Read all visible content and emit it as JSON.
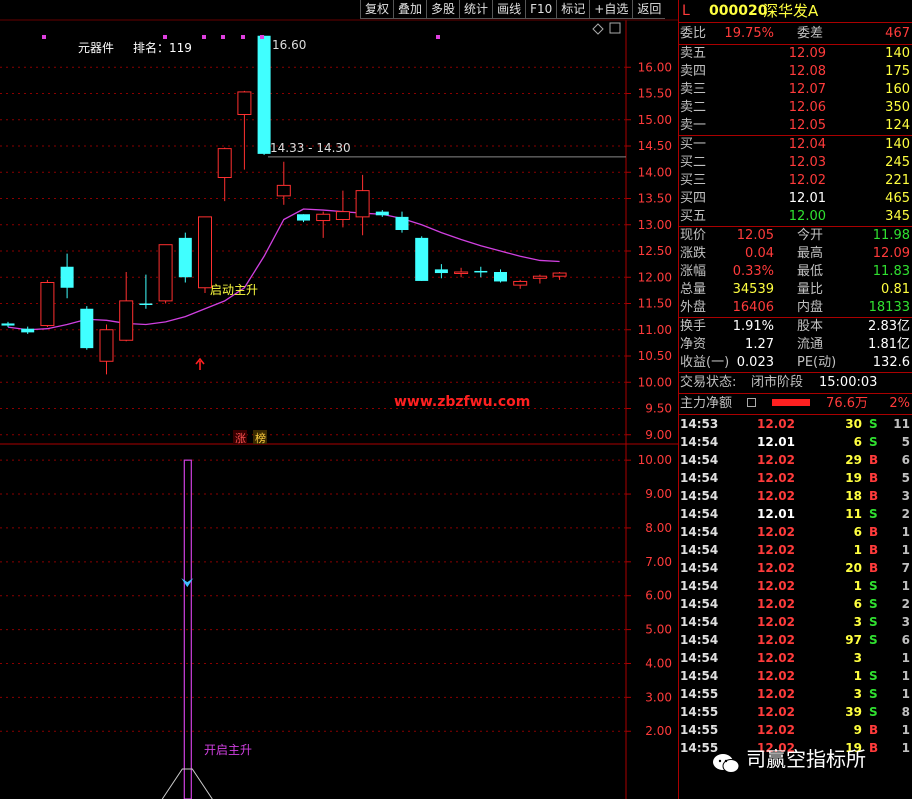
{
  "toolbar": {
    "items": [
      "复权",
      "叠加",
      "多股",
      "统计",
      "画线",
      "F10",
      "标记",
      "+自选",
      "返回"
    ]
  },
  "chart": {
    "indicator_name": "元器件",
    "rank_label": "排名：119",
    "high_label": "16.60",
    "range_label": "14.33 - 14.30",
    "signal_label": "启动主升",
    "signal_label_lower": "开启主升",
    "website": "www.zbzfwu.com",
    "tags": [
      "涨",
      "榜"
    ],
    "upper_ticks": [
      "16.00",
      "15.50",
      "15.00",
      "14.50",
      "14.00",
      "13.50",
      "13.00",
      "12.50",
      "12.00",
      "11.50",
      "11.00",
      "10.50",
      "10.00",
      "9.50",
      "9.00"
    ],
    "lower_ticks": [
      "10.00",
      "9.00",
      "8.00",
      "7.00",
      "6.00",
      "5.00",
      "4.00",
      "3.00",
      "2.00"
    ],
    "colors": {
      "up": "#ff3030",
      "down": "#40ffff",
      "ma": "#d040e0",
      "grid": "#8a0000"
    }
  },
  "chart_data": {
    "type": "candlestick",
    "candles": [
      {
        "o": 11.12,
        "h": 11.15,
        "l": 11.05,
        "c": 11.08
      },
      {
        "o": 11.02,
        "h": 11.06,
        "l": 10.92,
        "c": 10.95
      },
      {
        "o": 11.08,
        "h": 11.95,
        "l": 11.05,
        "c": 11.9
      },
      {
        "o": 12.2,
        "h": 12.45,
        "l": 11.6,
        "c": 11.8
      },
      {
        "o": 11.4,
        "h": 11.45,
        "l": 10.62,
        "c": 10.65
      },
      {
        "o": 10.4,
        "h": 11.1,
        "l": 10.15,
        "c": 11.0
      },
      {
        "o": 10.8,
        "h": 12.1,
        "l": 10.78,
        "c": 11.55
      },
      {
        "o": 11.5,
        "h": 12.05,
        "l": 11.4,
        "c": 11.48
      },
      {
        "o": 11.55,
        "h": 12.62,
        "l": 11.5,
        "c": 12.62
      },
      {
        "o": 12.75,
        "h": 12.85,
        "l": 11.9,
        "c": 12.0
      },
      {
        "o": 11.8,
        "h": 13.15,
        "l": 11.7,
        "c": 13.15
      },
      {
        "o": 13.9,
        "h": 14.47,
        "l": 13.45,
        "c": 14.45
      },
      {
        "o": 15.1,
        "h": 15.55,
        "l": 14.05,
        "c": 15.53
      },
      {
        "o": 16.6,
        "h": 16.6,
        "l": 14.33,
        "c": 14.35
      },
      {
        "o": 13.55,
        "h": 14.2,
        "l": 13.38,
        "c": 13.75
      },
      {
        "o": 13.2,
        "h": 13.2,
        "l": 13.05,
        "c": 13.08
      },
      {
        "o": 13.08,
        "h": 13.25,
        "l": 12.75,
        "c": 13.2
      },
      {
        "o": 13.1,
        "h": 13.65,
        "l": 12.95,
        "c": 13.25
      },
      {
        "o": 13.15,
        "h": 13.95,
        "l": 12.8,
        "c": 13.65
      },
      {
        "o": 13.25,
        "h": 13.28,
        "l": 13.15,
        "c": 13.18
      },
      {
        "o": 13.15,
        "h": 13.25,
        "l": 12.85,
        "c": 12.9
      },
      {
        "o": 12.75,
        "h": 12.78,
        "l": 11.93,
        "c": 11.93
      },
      {
        "o": 12.15,
        "h": 12.25,
        "l": 11.98,
        "c": 12.08
      },
      {
        "o": 12.08,
        "h": 12.18,
        "l": 12.0,
        "c": 12.1
      },
      {
        "o": 12.12,
        "h": 12.2,
        "l": 12.0,
        "c": 12.1
      },
      {
        "o": 12.1,
        "h": 12.15,
        "l": 11.9,
        "c": 11.92
      },
      {
        "o": 11.85,
        "h": 11.95,
        "l": 11.78,
        "c": 11.92
      },
      {
        "o": 11.98,
        "h": 12.05,
        "l": 11.88,
        "c": 12.02
      },
      {
        "o": 12.02,
        "h": 12.1,
        "l": 11.95,
        "c": 12.08
      }
    ],
    "ma": [
      11.05,
      11.0,
      11.02,
      11.1,
      11.2,
      11.18,
      11.12,
      11.1,
      11.15,
      11.25,
      11.4,
      11.55,
      11.8,
      12.4,
      13.1,
      13.3,
      13.28,
      13.25,
      13.22,
      13.2,
      13.12,
      13.0,
      12.85,
      12.72,
      12.6,
      12.5,
      12.4,
      12.32,
      12.3
    ],
    "yrange": [
      8.9,
      16.9
    ],
    "lower": {
      "spike_index": 9,
      "spike_value": 10.0,
      "marker_value": 6.4,
      "yrange": [
        0.0,
        10.3
      ]
    }
  },
  "panel": {
    "market": "L",
    "code": "000020",
    "name": "深华发A",
    "weibi_label": "委比",
    "weibi": "19.75%",
    "weicha_label": "委差",
    "weicha": "467",
    "asks": [
      {
        "label": "卖五",
        "price": "12.09",
        "vol": "140"
      },
      {
        "label": "卖四",
        "price": "12.08",
        "vol": "175"
      },
      {
        "label": "卖三",
        "price": "12.07",
        "vol": "160"
      },
      {
        "label": "卖二",
        "price": "12.06",
        "vol": "350"
      },
      {
        "label": "卖一",
        "price": "12.05",
        "vol": "124"
      }
    ],
    "bids": [
      {
        "label": "买一",
        "price": "12.04",
        "vol": "140"
      },
      {
        "label": "买二",
        "price": "12.03",
        "vol": "245"
      },
      {
        "label": "买三",
        "price": "12.02",
        "vol": "221"
      },
      {
        "label": "买四",
        "price": "12.01",
        "vol": "465"
      },
      {
        "label": "买五",
        "price": "12.00",
        "vol": "345"
      }
    ],
    "stats": [
      {
        "l1": "现价",
        "v1": "12.05",
        "c1": "red",
        "l2": "今开",
        "v2": "11.98",
        "c2": "grn"
      },
      {
        "l1": "涨跌",
        "v1": "0.04",
        "c1": "red",
        "l2": "最高",
        "v2": "12.09",
        "c2": "red"
      },
      {
        "l1": "涨幅",
        "v1": "0.33%",
        "c1": "red",
        "l2": "最低",
        "v2": "11.83",
        "c2": "grn"
      },
      {
        "l1": "总量",
        "v1": "34539",
        "c1": "yel",
        "l2": "量比",
        "v2": "0.81",
        "c2": "yel"
      },
      {
        "l1": "外盘",
        "v1": "16406",
        "c1": "red",
        "l2": "内盘",
        "v2": "18133",
        "c2": "grn"
      }
    ],
    "stats2": [
      {
        "l1": "换手",
        "v1": "1.91%",
        "l2": "股本",
        "v2": "2.83亿"
      },
      {
        "l1": "净资",
        "v1": "1.27",
        "l2": "流通",
        "v2": "1.81亿"
      },
      {
        "l1": "收益(一)",
        "v1": "0.023",
        "l2": "PE(动)",
        "v2": "132.6"
      }
    ],
    "status_label": "交易状态:",
    "status_value": "闭市阶段",
    "status_time": "15:00:03",
    "main_label": "主力净额",
    "main_value": "76.6万",
    "main_pct": "2%",
    "ticks": [
      {
        "t": "14:53",
        "p": "12.02",
        "pc": "red",
        "v": "30",
        "bs": "S",
        "n": "11"
      },
      {
        "t": "14:54",
        "p": "12.01",
        "pc": "wht",
        "v": "6",
        "bs": "S",
        "n": "5"
      },
      {
        "t": "14:54",
        "p": "12.02",
        "pc": "red",
        "v": "29",
        "bs": "B",
        "n": "6"
      },
      {
        "t": "14:54",
        "p": "12.02",
        "pc": "red",
        "v": "19",
        "bs": "B",
        "n": "5"
      },
      {
        "t": "14:54",
        "p": "12.02",
        "pc": "red",
        "v": "18",
        "bs": "B",
        "n": "3"
      },
      {
        "t": "14:54",
        "p": "12.01",
        "pc": "wht",
        "v": "11",
        "bs": "S",
        "n": "2"
      },
      {
        "t": "14:54",
        "p": "12.02",
        "pc": "red",
        "v": "6",
        "bs": "B",
        "n": "1"
      },
      {
        "t": "14:54",
        "p": "12.02",
        "pc": "red",
        "v": "1",
        "bs": "B",
        "n": "1"
      },
      {
        "t": "14:54",
        "p": "12.02",
        "pc": "red",
        "v": "20",
        "bs": "B",
        "n": "7"
      },
      {
        "t": "14:54",
        "p": "12.02",
        "pc": "red",
        "v": "1",
        "bs": "S",
        "n": "1"
      },
      {
        "t": "14:54",
        "p": "12.02",
        "pc": "red",
        "v": "6",
        "bs": "S",
        "n": "2"
      },
      {
        "t": "14:54",
        "p": "12.02",
        "pc": "red",
        "v": "3",
        "bs": "S",
        "n": "3"
      },
      {
        "t": "14:54",
        "p": "12.02",
        "pc": "red",
        "v": "97",
        "bs": "S",
        "n": "6"
      },
      {
        "t": "14:54",
        "p": "12.02",
        "pc": "red",
        "v": "3",
        "bs": "",
        "n": "1"
      },
      {
        "t": "14:54",
        "p": "12.02",
        "pc": "red",
        "v": "1",
        "bs": "S",
        "n": "1"
      },
      {
        "t": "14:55",
        "p": "12.02",
        "pc": "red",
        "v": "3",
        "bs": "S",
        "n": "1"
      },
      {
        "t": "14:55",
        "p": "12.02",
        "pc": "red",
        "v": "39",
        "bs": "S",
        "n": "8"
      },
      {
        "t": "14:55",
        "p": "12.02",
        "pc": "red",
        "v": "9",
        "bs": "B",
        "n": "1"
      },
      {
        "t": "14:55",
        "p": "12.02",
        "pc": "red",
        "v": "19",
        "bs": "B",
        "n": "1"
      }
    ],
    "watermark": "司赢空指标所"
  }
}
